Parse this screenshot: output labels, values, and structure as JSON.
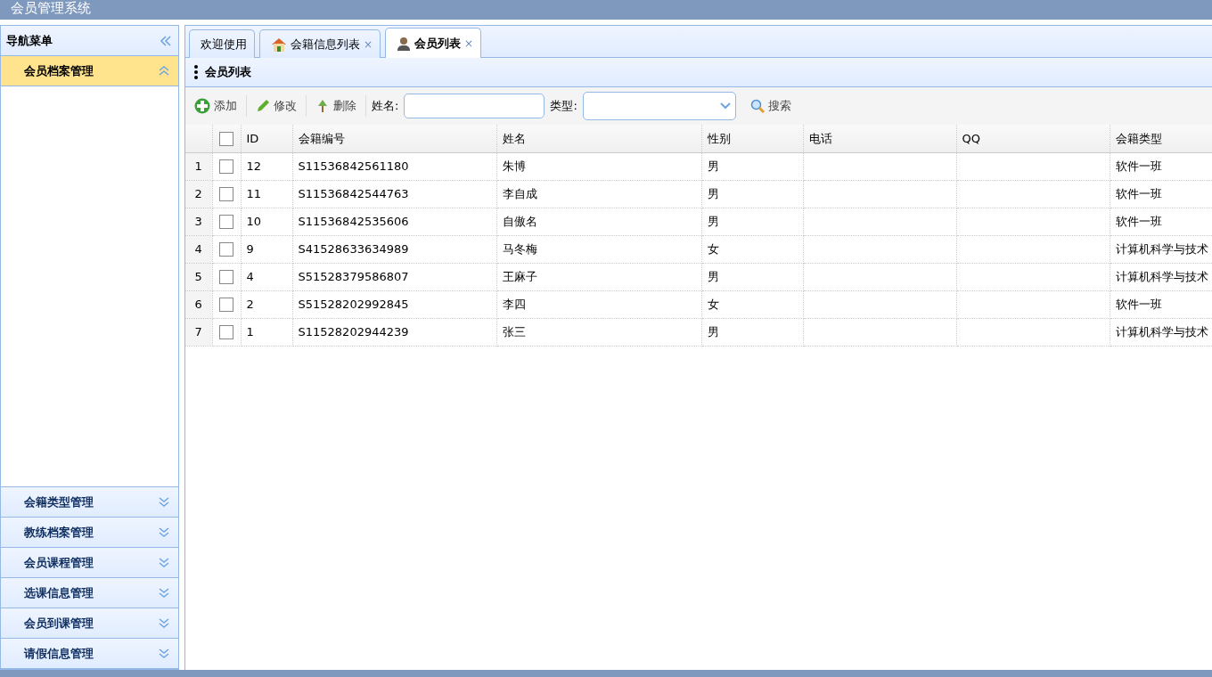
{
  "window": {
    "title": "会员管理系统"
  },
  "nav": {
    "title": "导航菜单",
    "items": [
      {
        "label": "会员档案管理",
        "expanded": true
      },
      {
        "label": "会籍类型管理",
        "expanded": false
      },
      {
        "label": "教练档案管理",
        "expanded": false
      },
      {
        "label": "会员课程管理",
        "expanded": false
      },
      {
        "label": "选课信息管理",
        "expanded": false
      },
      {
        "label": "会员到课管理",
        "expanded": false
      },
      {
        "label": "请假信息管理",
        "expanded": false
      }
    ]
  },
  "tabs": [
    {
      "label": "欢迎使用",
      "kind": "plain",
      "selected": false
    },
    {
      "label": "会籍信息列表",
      "kind": "home",
      "close": "×",
      "selected": false
    },
    {
      "label": "会员列表",
      "kind": "user",
      "close": "×",
      "selected": true
    }
  ],
  "panel": {
    "title": "会员列表"
  },
  "toolbar": [
    {
      "label": "添加",
      "kind": "add"
    },
    {
      "label": "修改",
      "kind": "edit"
    },
    {
      "label": "删除",
      "kind": "delete"
    }
  ],
  "filters": {
    "name_label": "姓名:",
    "type_label": "类型:",
    "search_label": "搜索"
  },
  "table": {
    "all_checked": false,
    "columns": [
      "ID",
      "会籍编号",
      "姓名",
      "性别",
      "电话",
      "QQ",
      "会籍类型"
    ],
    "rows": [
      {
        "num": "1",
        "checked": false,
        "cells": [
          "12",
          "S11536842561180",
          "朱博",
          "男",
          "",
          "",
          "软件一班"
        ]
      },
      {
        "num": "2",
        "checked": false,
        "cells": [
          "11",
          "S11536842544763",
          "李自成",
          "男",
          "",
          "",
          "软件一班"
        ]
      },
      {
        "num": "3",
        "checked": false,
        "cells": [
          "10",
          "S11536842535606",
          "自傲名",
          "男",
          "",
          "",
          "软件一班"
        ]
      },
      {
        "num": "4",
        "checked": false,
        "cells": [
          "9",
          "S41528633634989",
          "马冬梅",
          "女",
          "",
          "",
          "计算机科学与技术"
        ]
      },
      {
        "num": "5",
        "checked": false,
        "cells": [
          "4",
          "S51528379586807",
          "王麻子",
          "男",
          "",
          "",
          "计算机科学与技术"
        ]
      },
      {
        "num": "6",
        "checked": false,
        "cells": [
          "2",
          "S51528202992845",
          "李四",
          "女",
          "",
          "",
          "软件一班"
        ]
      },
      {
        "num": "7",
        "checked": false,
        "cells": [
          "1",
          "S11528202944239",
          "张三",
          "男",
          "",
          "",
          "计算机科学与技术"
        ]
      }
    ]
  }
}
